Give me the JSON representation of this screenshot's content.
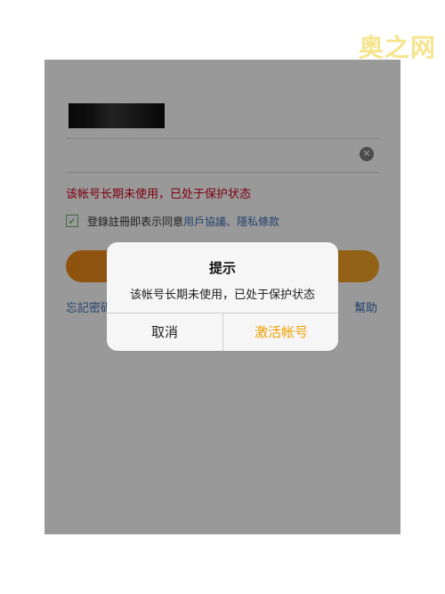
{
  "watermark": {
    "text": "奥之网"
  },
  "login": {
    "status_message": "该帐号长期未使用，已处于保护状态",
    "agree_prefix": "登錄註冊即表示同意",
    "agree_link1": "用戶協議",
    "agree_sep": "、",
    "agree_link2": "隱私條款",
    "forgot_label": "忘記密碼",
    "help_label": "幫助",
    "checkbox_glyph": "✓",
    "clear_glyph": "✕"
  },
  "alert": {
    "title": "提示",
    "message": "该帐号长期未使用，已处于保护状态",
    "cancel_label": "取消",
    "activate_label": "激活帐号"
  },
  "colors": {
    "accent": "#f0a000",
    "error": "#d0021b",
    "link": "#3b6fb5"
  }
}
